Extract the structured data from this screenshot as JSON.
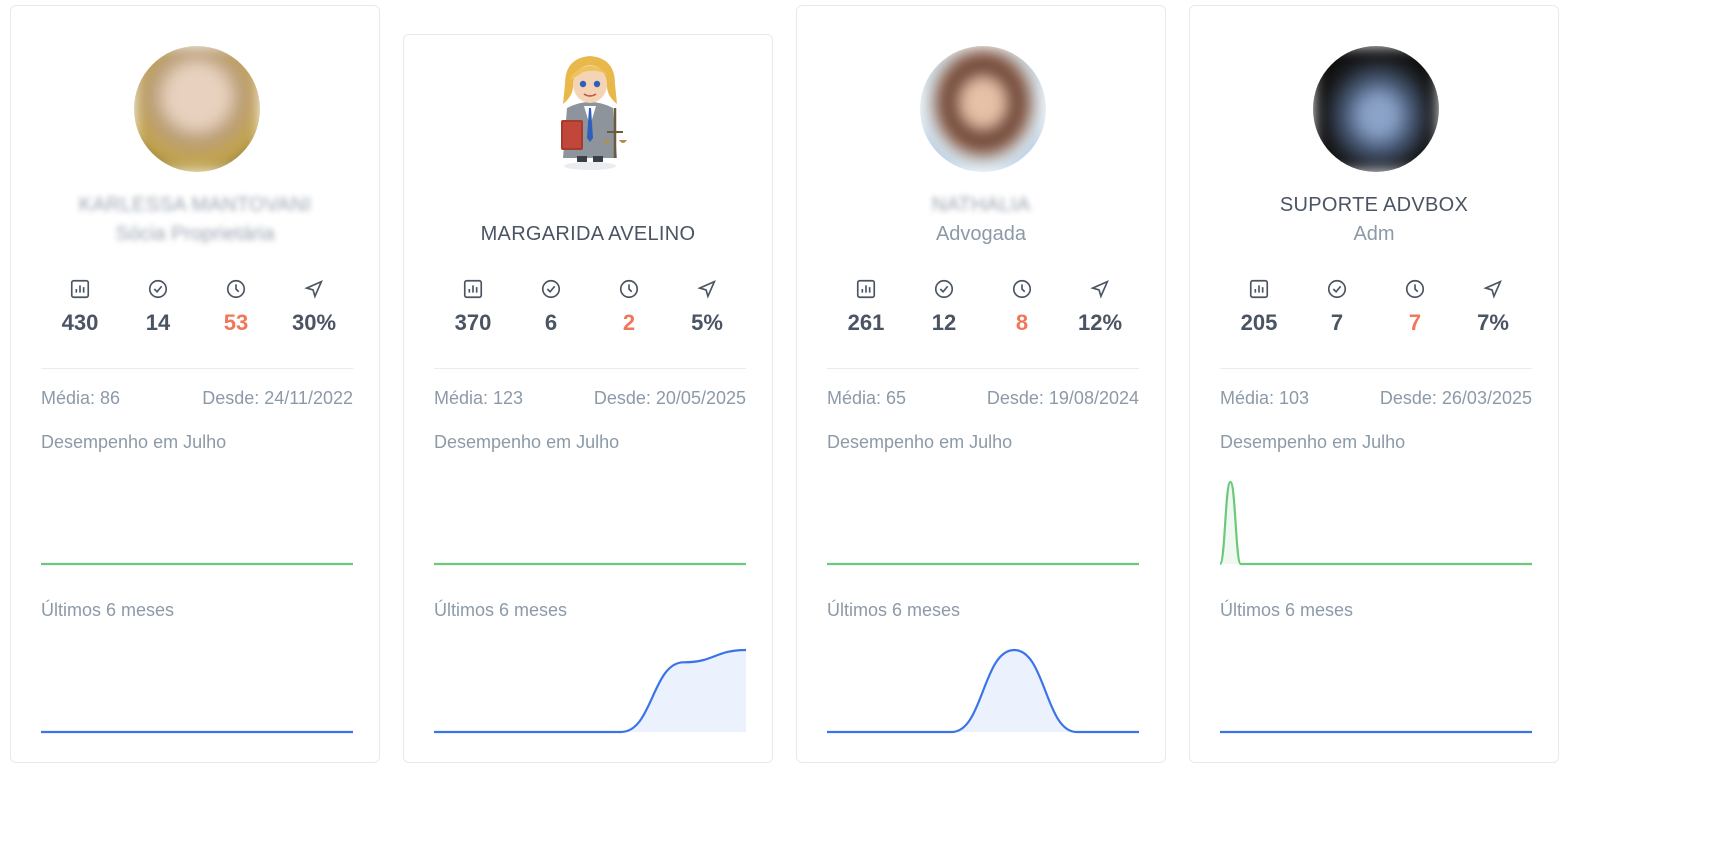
{
  "cards": [
    {
      "name": "KARLESSA MANTOVANI",
      "role": "Sócia Proprietária",
      "blurred_name": true,
      "blurred_role": true,
      "avatar_icon": "user-photo-blurred",
      "stats": {
        "total": "430",
        "done": "14",
        "pending": "53",
        "rate": "30%"
      },
      "media": "Média: 86",
      "desde": "Desde: 24/11/2022",
      "monthly_label": "Desempenho em Julho",
      "history_label": "Últimos 6 meses",
      "monthly_series": [
        0,
        0,
        0,
        0,
        0,
        0,
        0,
        0,
        0,
        0,
        0,
        0,
        0,
        0,
        0,
        0,
        0,
        0,
        0,
        0,
        0,
        0,
        0,
        0,
        0,
        0,
        0,
        0,
        0,
        0,
        0
      ],
      "history_series": [
        0,
        0,
        0,
        0,
        0,
        0
      ]
    },
    {
      "name": "MARGARIDA AVELINO",
      "role": "",
      "blurred_name": false,
      "blurred_role": false,
      "avatar_icon": "lawyer-illustration",
      "stats": {
        "total": "370",
        "done": "6",
        "pending": "2",
        "rate": "5%"
      },
      "media": "Média: 123",
      "desde": "Desde: 20/05/2025",
      "monthly_label": "Desempenho em Julho",
      "history_label": "Últimos 6 meses",
      "monthly_series": [
        0,
        0,
        0,
        0,
        0,
        0,
        0,
        0,
        0,
        0,
        0,
        0,
        0,
        0,
        0,
        0,
        0,
        0,
        0,
        0,
        0,
        0,
        0,
        0,
        0,
        0,
        0,
        0,
        0,
        0,
        0
      ],
      "history_series": [
        0,
        0,
        0,
        0,
        85,
        100
      ]
    },
    {
      "name": "NATHALIA",
      "role": "Advogada",
      "blurred_name": true,
      "blurred_role": false,
      "avatar_icon": "user-photo-blurred",
      "stats": {
        "total": "261",
        "done": "12",
        "pending": "8",
        "rate": "12%"
      },
      "media": "Média: 65",
      "desde": "Desde: 19/08/2024",
      "monthly_label": "Desempenho em Julho",
      "history_label": "Últimos 6 meses",
      "monthly_series": [
        0,
        0,
        0,
        0,
        0,
        0,
        0,
        0,
        0,
        0,
        0,
        0,
        0,
        0,
        0,
        0,
        0,
        0,
        0,
        0,
        0,
        0,
        0,
        0,
        0,
        0,
        0,
        0,
        0,
        0,
        0
      ],
      "history_series": [
        0,
        0,
        0,
        100,
        0,
        0
      ]
    },
    {
      "name": "SUPORTE ADVBOX",
      "role": "Adm",
      "blurred_name": false,
      "blurred_role": false,
      "avatar_icon": "user-photo-blurred",
      "stats": {
        "total": "205",
        "done": "7",
        "pending": "7",
        "rate": "7%"
      },
      "media": "Média: 103",
      "desde": "Desde: 26/03/2025",
      "monthly_label": "Desempenho em Julho",
      "history_label": "Últimos 6 meses",
      "monthly_series": [
        0,
        1,
        0,
        0,
        0,
        0,
        0,
        0,
        0,
        0,
        0,
        0,
        0,
        0,
        0,
        0,
        0,
        0,
        0,
        0,
        0,
        0,
        0,
        0,
        0,
        0,
        0,
        0,
        0,
        0,
        0
      ],
      "history_series": [
        0,
        0,
        0,
        0,
        0,
        0
      ]
    }
  ],
  "colors": {
    "monthly_line": "#6cc97a",
    "history_line": "#3b74e8",
    "warning": "#f0775a"
  },
  "icons": [
    "bar-chart-icon",
    "check-circle-icon",
    "clock-icon",
    "send-icon"
  ]
}
